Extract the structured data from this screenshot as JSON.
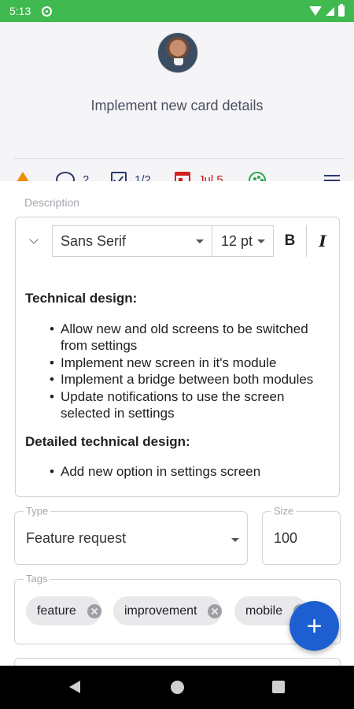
{
  "status_bar": {
    "time": "5:13"
  },
  "header": {
    "title": "Implement new card details"
  },
  "meta": {
    "comments_count": "2",
    "checklist": "1/2",
    "due_date": "Jul 5",
    "colors": {
      "priority": "#f08c00",
      "due": "#c11b1b",
      "palette": "#2aa84a",
      "accent": "#1d5fd1"
    }
  },
  "description": {
    "label": "Description",
    "toolbar": {
      "font": "Sans Serif",
      "size": "12 pt",
      "bold": "B",
      "italic": "I"
    },
    "heading1": "Technical design:",
    "items1": [
      "Allow new and old screens to be switched from settings",
      "Implement new screen in it's module",
      "Implement a bridge between both modules",
      "Update notifications to use the screen selected in settings"
    ],
    "heading2": "Detailed technical design:",
    "items2": [
      "Add new option in settings screen"
    ]
  },
  "type_field": {
    "label": "Type",
    "value": "Feature request"
  },
  "size_field": {
    "label": "Size",
    "value": "100"
  },
  "tags": {
    "label": "Tags",
    "items": [
      "feature",
      "improvement",
      "mobile"
    ]
  },
  "fab": {
    "label": "+"
  }
}
